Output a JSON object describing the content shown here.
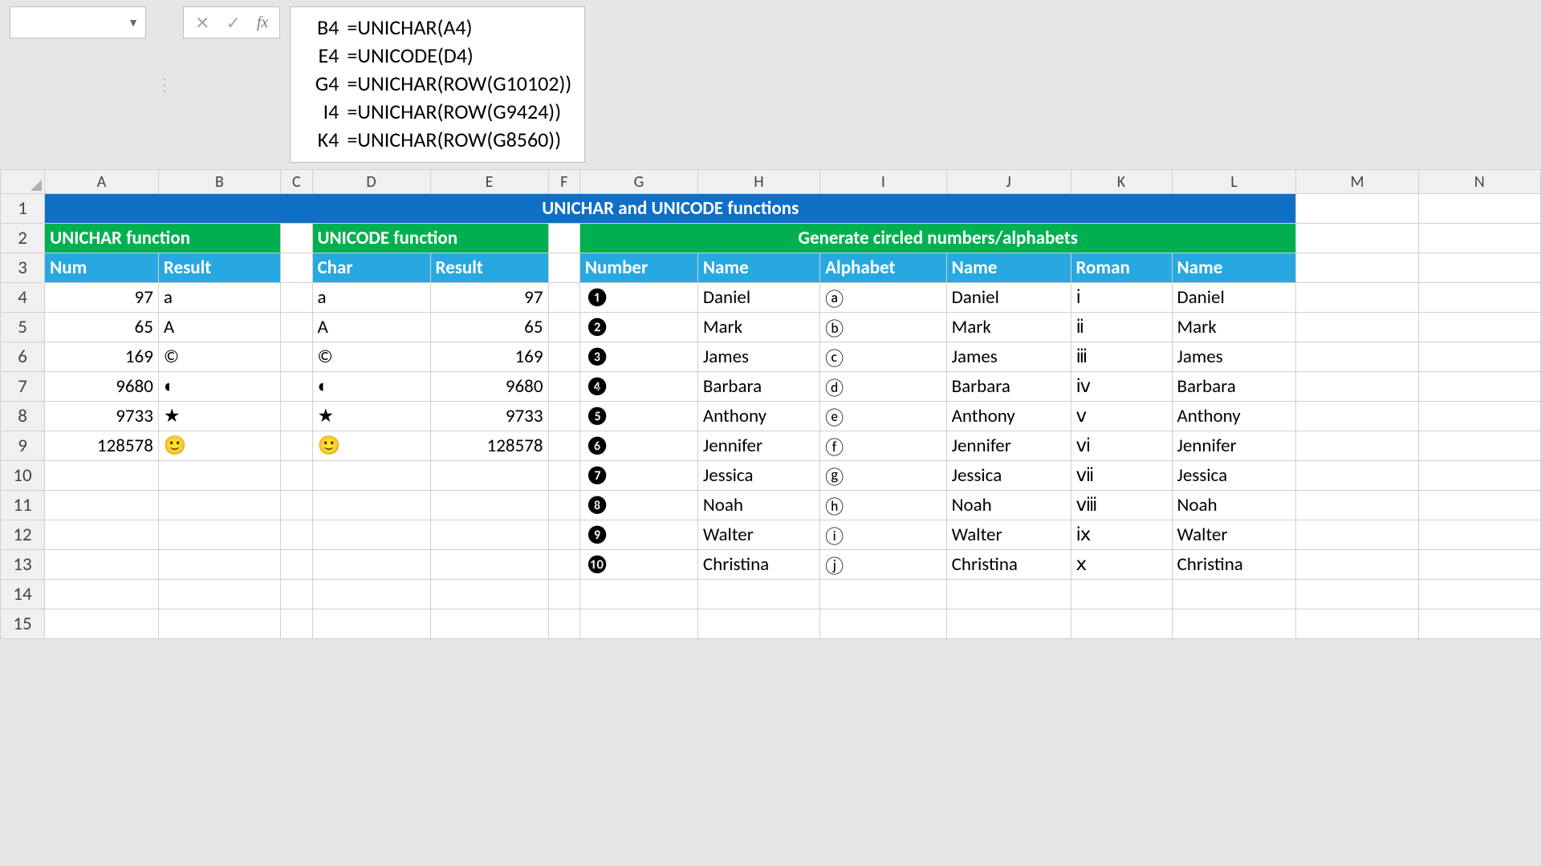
{
  "formula_bar": {
    "formulas": [
      {
        "ref": "B4",
        "expr": "=UNICHAR(A4)"
      },
      {
        "ref": "E4",
        "expr": "=UNICODE(D4)"
      },
      {
        "ref": "G4",
        "expr": "=UNICHAR(ROW(G10102))"
      },
      {
        "ref": "I4",
        "expr": "=UNICHAR(ROW(G9424))"
      },
      {
        "ref": "K4",
        "expr": "=UNICHAR(ROW(G8560))"
      }
    ]
  },
  "columns": [
    "A",
    "B",
    "C",
    "D",
    "E",
    "F",
    "G",
    "H",
    "I",
    "J",
    "K",
    "L",
    "M",
    "N"
  ],
  "title": "UNICHAR and UNICODE functions",
  "sections": {
    "unichar": "UNICHAR function",
    "unicode": "UNICODE function",
    "circled": "Generate circled numbers/alphabets"
  },
  "headers": {
    "num": "Num",
    "result": "Result",
    "char": "Char",
    "result2": "Result",
    "number": "Number",
    "name": "Name",
    "alphabet": "Alphabet",
    "name2": "Name",
    "roman": "Roman",
    "name3": "Name"
  },
  "unichar_rows": [
    {
      "num": 97,
      "result": "a"
    },
    {
      "num": 65,
      "result": "A"
    },
    {
      "num": 169,
      "result": "©"
    },
    {
      "num": 9680,
      "result": "◐"
    },
    {
      "num": 9733,
      "result": "★"
    },
    {
      "num": 128578,
      "result": "🙂"
    }
  ],
  "unicode_rows": [
    {
      "char": "a",
      "result": 97
    },
    {
      "char": "A",
      "result": 65
    },
    {
      "char": "©",
      "result": 169
    },
    {
      "char": "◐",
      "result": 9680
    },
    {
      "char": "★",
      "result": 9733
    },
    {
      "char": "🙂",
      "result": 128578
    }
  ],
  "circled_rows": [
    {
      "num": "❶",
      "name1": "Daniel",
      "alpha": "ⓐ",
      "name2": "Daniel",
      "roman": "ⅰ",
      "name3": "Daniel"
    },
    {
      "num": "❷",
      "name1": "Mark",
      "alpha": "ⓑ",
      "name2": "Mark",
      "roman": "ⅱ",
      "name3": "Mark"
    },
    {
      "num": "❸",
      "name1": "James",
      "alpha": "ⓒ",
      "name2": "James",
      "roman": "ⅲ",
      "name3": "James"
    },
    {
      "num": "❹",
      "name1": "Barbara",
      "alpha": "ⓓ",
      "name2": "Barbara",
      "roman": "ⅳ",
      "name3": "Barbara"
    },
    {
      "num": "❺",
      "name1": "Anthony",
      "alpha": "ⓔ",
      "name2": "Anthony",
      "roman": "ⅴ",
      "name3": "Anthony"
    },
    {
      "num": "❻",
      "name1": "Jennifer",
      "alpha": "ⓕ",
      "name2": "Jennifer",
      "roman": "ⅵ",
      "name3": "Jennifer"
    },
    {
      "num": "❼",
      "name1": "Jessica",
      "alpha": "ⓖ",
      "name2": "Jessica",
      "roman": "ⅶ",
      "name3": "Jessica"
    },
    {
      "num": "❽",
      "name1": "Noah",
      "alpha": "ⓗ",
      "name2": "Noah",
      "roman": "ⅷ",
      "name3": "Noah"
    },
    {
      "num": "❾",
      "name1": "Walter",
      "alpha": "ⓘ",
      "name2": "Walter",
      "roman": "ⅸ",
      "name3": "Walter"
    },
    {
      "num": "❿",
      "name1": "Christina",
      "alpha": "ⓙ",
      "name2": "Christina",
      "roman": "ⅹ",
      "name3": "Christina"
    }
  ]
}
